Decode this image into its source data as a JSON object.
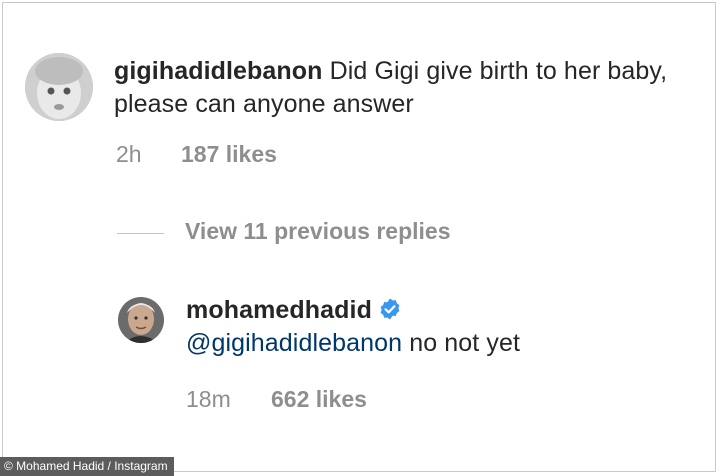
{
  "comments": [
    {
      "username": "gigihadidlebanon",
      "text": " Did Gigi give birth to her baby, please can anyone answer",
      "time": "2h",
      "likes": "187 likes",
      "avatar_icon": "baby-photo-avatar"
    },
    {
      "username": "mohamedhadid",
      "verified": true,
      "verified_icon": "verified-badge-icon",
      "mention": "@gigihadidlebanon",
      "text": " no not yet",
      "time": "18m",
      "likes": "662 likes",
      "avatar_icon": "man-photo-avatar"
    }
  ],
  "replies": {
    "view_label": "View 11 previous replies"
  },
  "credit": "© Mohamed Hadid / Instagram",
  "colors": {
    "primary_text": "#262626",
    "secondary_text": "#8e8e8e",
    "mention": "#00376b",
    "verified": "#3897f0"
  }
}
